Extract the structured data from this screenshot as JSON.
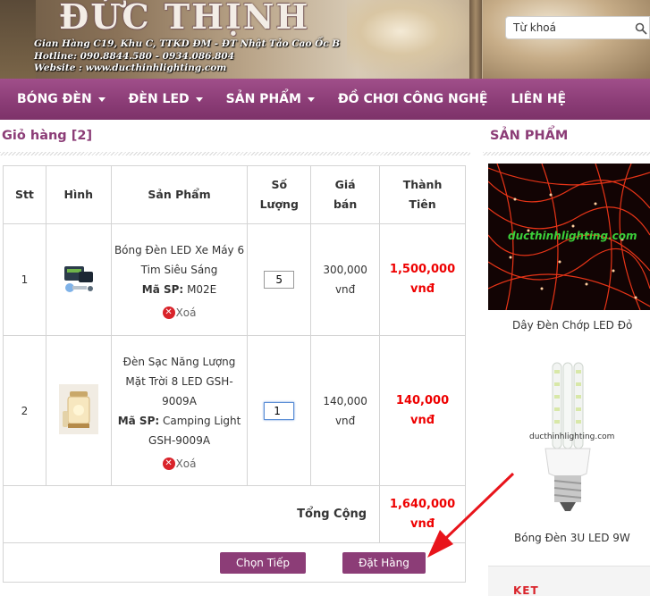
{
  "header": {
    "brand": "ĐỨC THỊNH",
    "address": "Gian Hàng C19, Khu C, TTKD ĐM - ĐT Nhật Tảo Cao Ốc B",
    "hotline": "Hotline: 090.8844.580 - 0934.086.804",
    "website": "Website : www.ducthinhlighting.com",
    "search_placeholder": "Từ khoá"
  },
  "nav": {
    "items": [
      {
        "label": "BÓNG ĐÈN",
        "has_dropdown": true
      },
      {
        "label": "ĐÈN LED",
        "has_dropdown": true
      },
      {
        "label": "SẢN PHẨM",
        "has_dropdown": true
      },
      {
        "label": "ĐỒ CHƠI CÔNG NGHỆ",
        "has_dropdown": false
      },
      {
        "label": "LIÊN HỆ",
        "has_dropdown": false
      }
    ]
  },
  "cart": {
    "title": "Giỏ hàng [2]",
    "headers": {
      "stt": "Stt",
      "image": "Hình",
      "product": "Sản Phẩm",
      "qty_1": "Số",
      "qty_2": "Lượng",
      "price_1": "Giá",
      "price_2": "bán",
      "total_1": "Thành",
      "total_2": "Tiên"
    },
    "items": [
      {
        "stt": "1",
        "name": "Bóng Đèn LED Xe Máy 6 Tim Siêu Sáng",
        "code_label": "Mã SP:",
        "code": "M02E",
        "qty": "5",
        "price": "300,000",
        "price_unit": "vnđ",
        "total": "1,500,000",
        "total_unit": "vnđ",
        "remove_label": "Xoá"
      },
      {
        "stt": "2",
        "name": "Đèn Sạc Năng Lượng Mặt Trời 8 LED GSH-9009A",
        "code_label": "Mã SP:",
        "code": "Camping Light GSH-9009A",
        "qty": "1",
        "price": "140,000",
        "price_unit": "vnđ",
        "total": "140,000",
        "total_unit": "vnđ",
        "remove_label": "Xoá"
      }
    ],
    "sum_label": "Tổng Cộng",
    "sum_value": "1,640,000",
    "sum_unit": "vnđ",
    "continue_label": "Chọn Tiếp",
    "order_label": "Đặt Hàng"
  },
  "sidebar": {
    "title": "SẢN PHẨM",
    "products": [
      {
        "caption": "Dây Đèn Chớp LED Đỏ",
        "watermark": "ducthinhlighting.com"
      },
      {
        "caption": "Bóng Đèn 3U LED 9W",
        "watermark": "ducthinhlighting.com"
      },
      {
        "logo": "KET"
      }
    ]
  },
  "colors": {
    "accent": "#8c3d77",
    "price_red": "#e00000",
    "remove_red": "#d9232a",
    "annotation_arrow": "#e8141b"
  }
}
